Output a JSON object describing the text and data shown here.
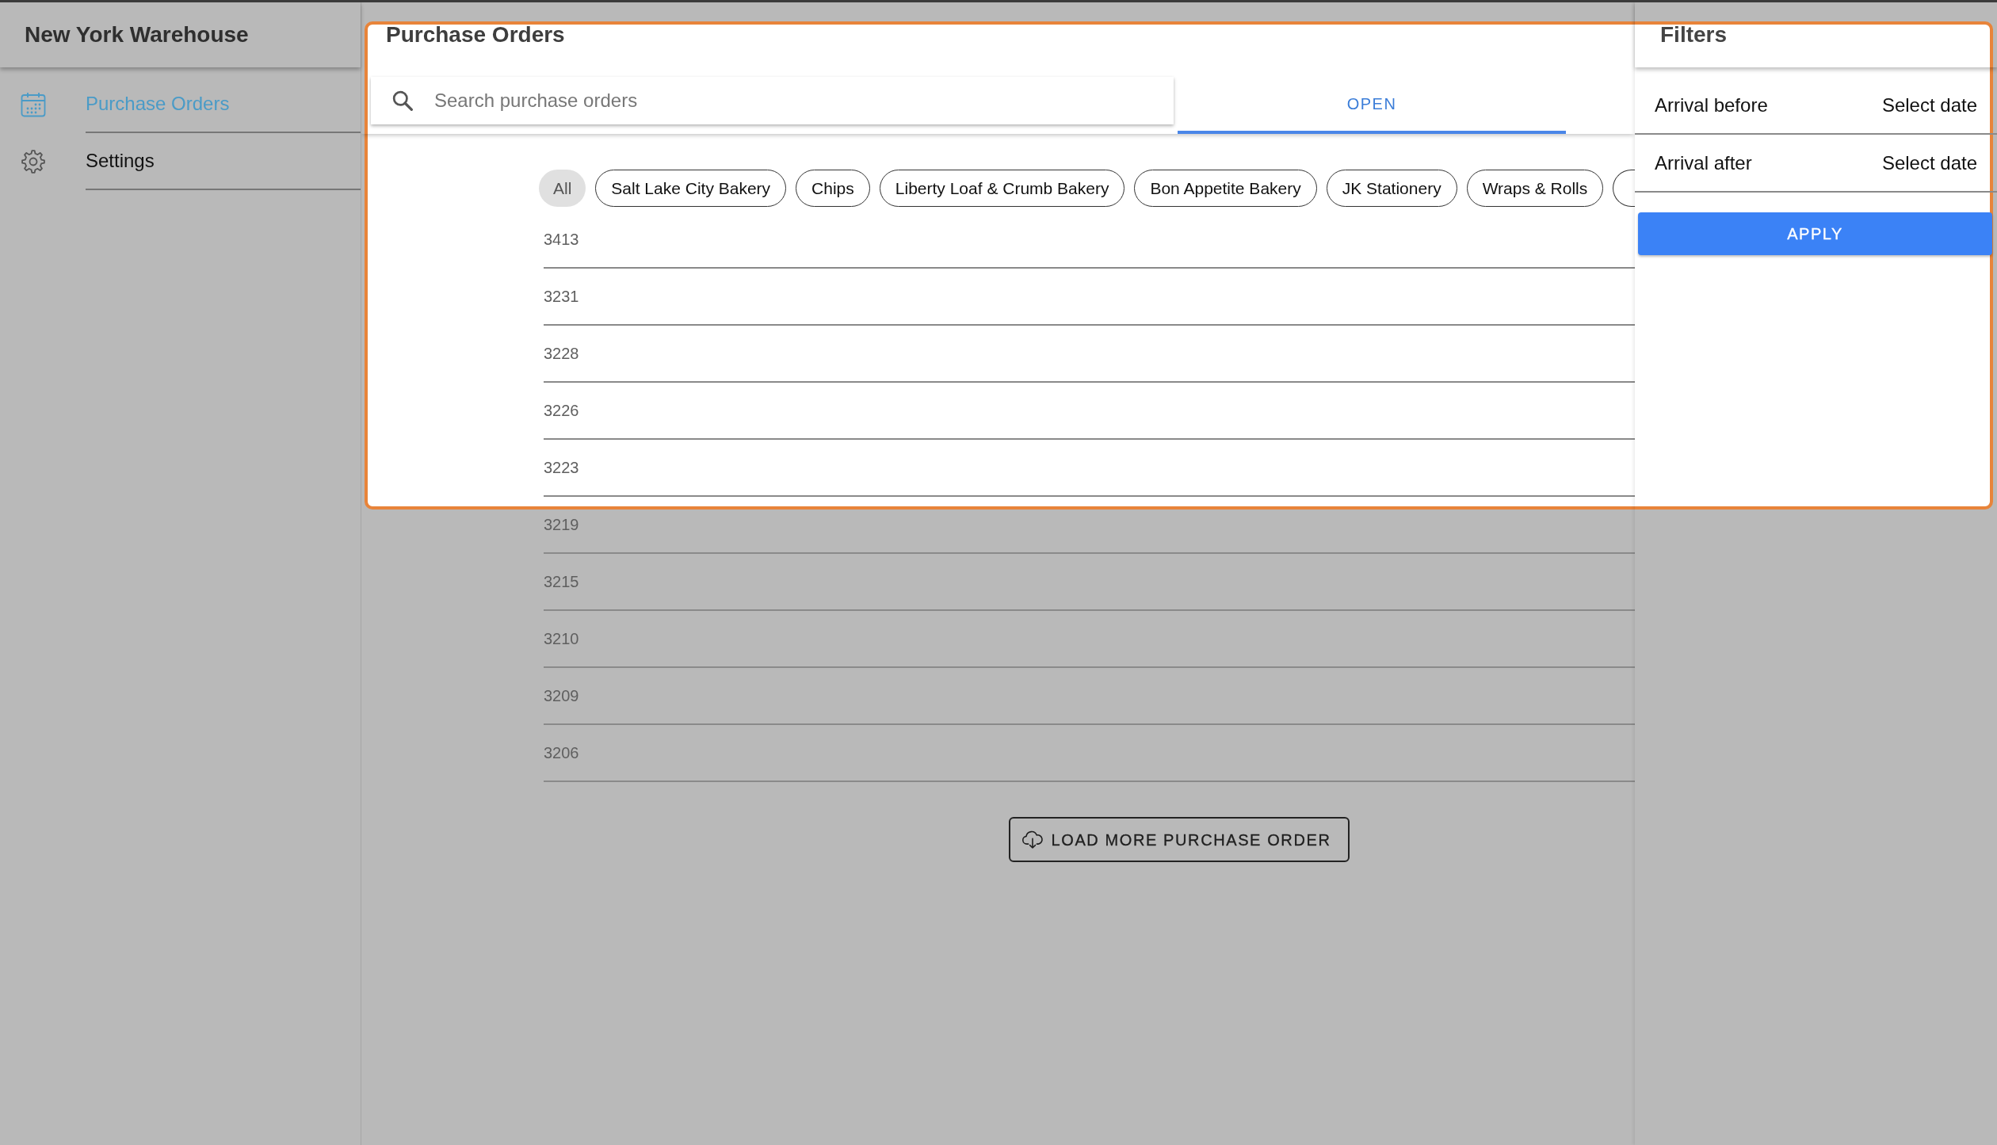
{
  "highlight_frame": true,
  "sidebar": {
    "title": "New York Warehouse",
    "items": [
      {
        "label": "Purchase Orders",
        "kind": "calendar",
        "selected": true
      },
      {
        "label": "Settings",
        "kind": "gear",
        "selected": false
      }
    ]
  },
  "orders_panel": {
    "title": "Purchase Orders",
    "search": {
      "placeholder": "Search purchase orders"
    },
    "tabs": [
      {
        "label": "OPEN",
        "selected": true
      }
    ],
    "chips": [
      {
        "label": "All",
        "selected": true
      },
      {
        "label": "Salt Lake City Bakery",
        "selected": false
      },
      {
        "label": "Chips",
        "selected": false
      },
      {
        "label": "Liberty Loaf & Crumb Bakery",
        "selected": false
      },
      {
        "label": "Bon Appetite Bakery",
        "selected": false
      },
      {
        "label": "JK Stationery",
        "selected": false
      },
      {
        "label": "Wraps & Rolls",
        "selected": false
      }
    ],
    "more_chips_cut_off": true,
    "orders": [
      "3413",
      "3231",
      "3228",
      "3226",
      "3223",
      "3219",
      "3215",
      "3210",
      "3209",
      "3206"
    ],
    "load_more_button": "LOAD MORE PURCHASE ORDER"
  },
  "filters": {
    "title": "Filters",
    "fields": [
      {
        "label": "Arrival before",
        "placeholder": "Select date"
      },
      {
        "label": "Arrival after",
        "placeholder": "Select date"
      }
    ],
    "apply_button": "APPLY"
  }
}
